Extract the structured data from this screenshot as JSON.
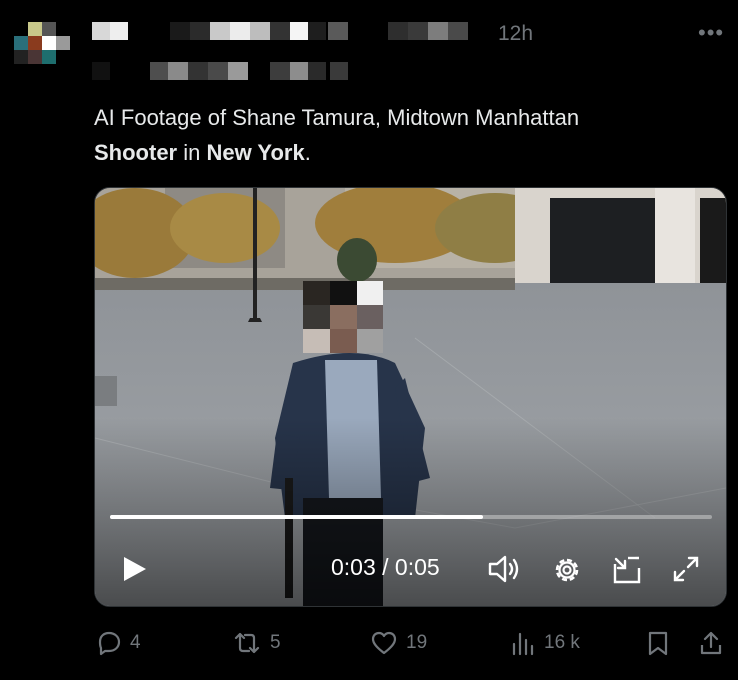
{
  "post": {
    "time": "12h",
    "more_label": "•••",
    "text_plain": "AI Footage of Shane Tamura, Midtown Manhattan",
    "text_bold1": "Shooter",
    "text_mid": " in ",
    "text_bold2": "New York",
    "text_end": "."
  },
  "video": {
    "timecode": "0:03 / 0:05",
    "progress": 0.62
  },
  "actions": {
    "replies": "4",
    "reposts": "5",
    "likes": "19",
    "views": "16 k"
  },
  "colors": {
    "background": "#000000",
    "text": "#e7e9ea",
    "muted": "#71767b"
  },
  "icons": [
    "more-icon",
    "play-icon",
    "volume-icon",
    "settings-icon",
    "pip-icon",
    "fullscreen-icon",
    "reply-icon",
    "repost-icon",
    "like-icon",
    "views-icon",
    "bookmark-icon",
    "share-icon"
  ]
}
